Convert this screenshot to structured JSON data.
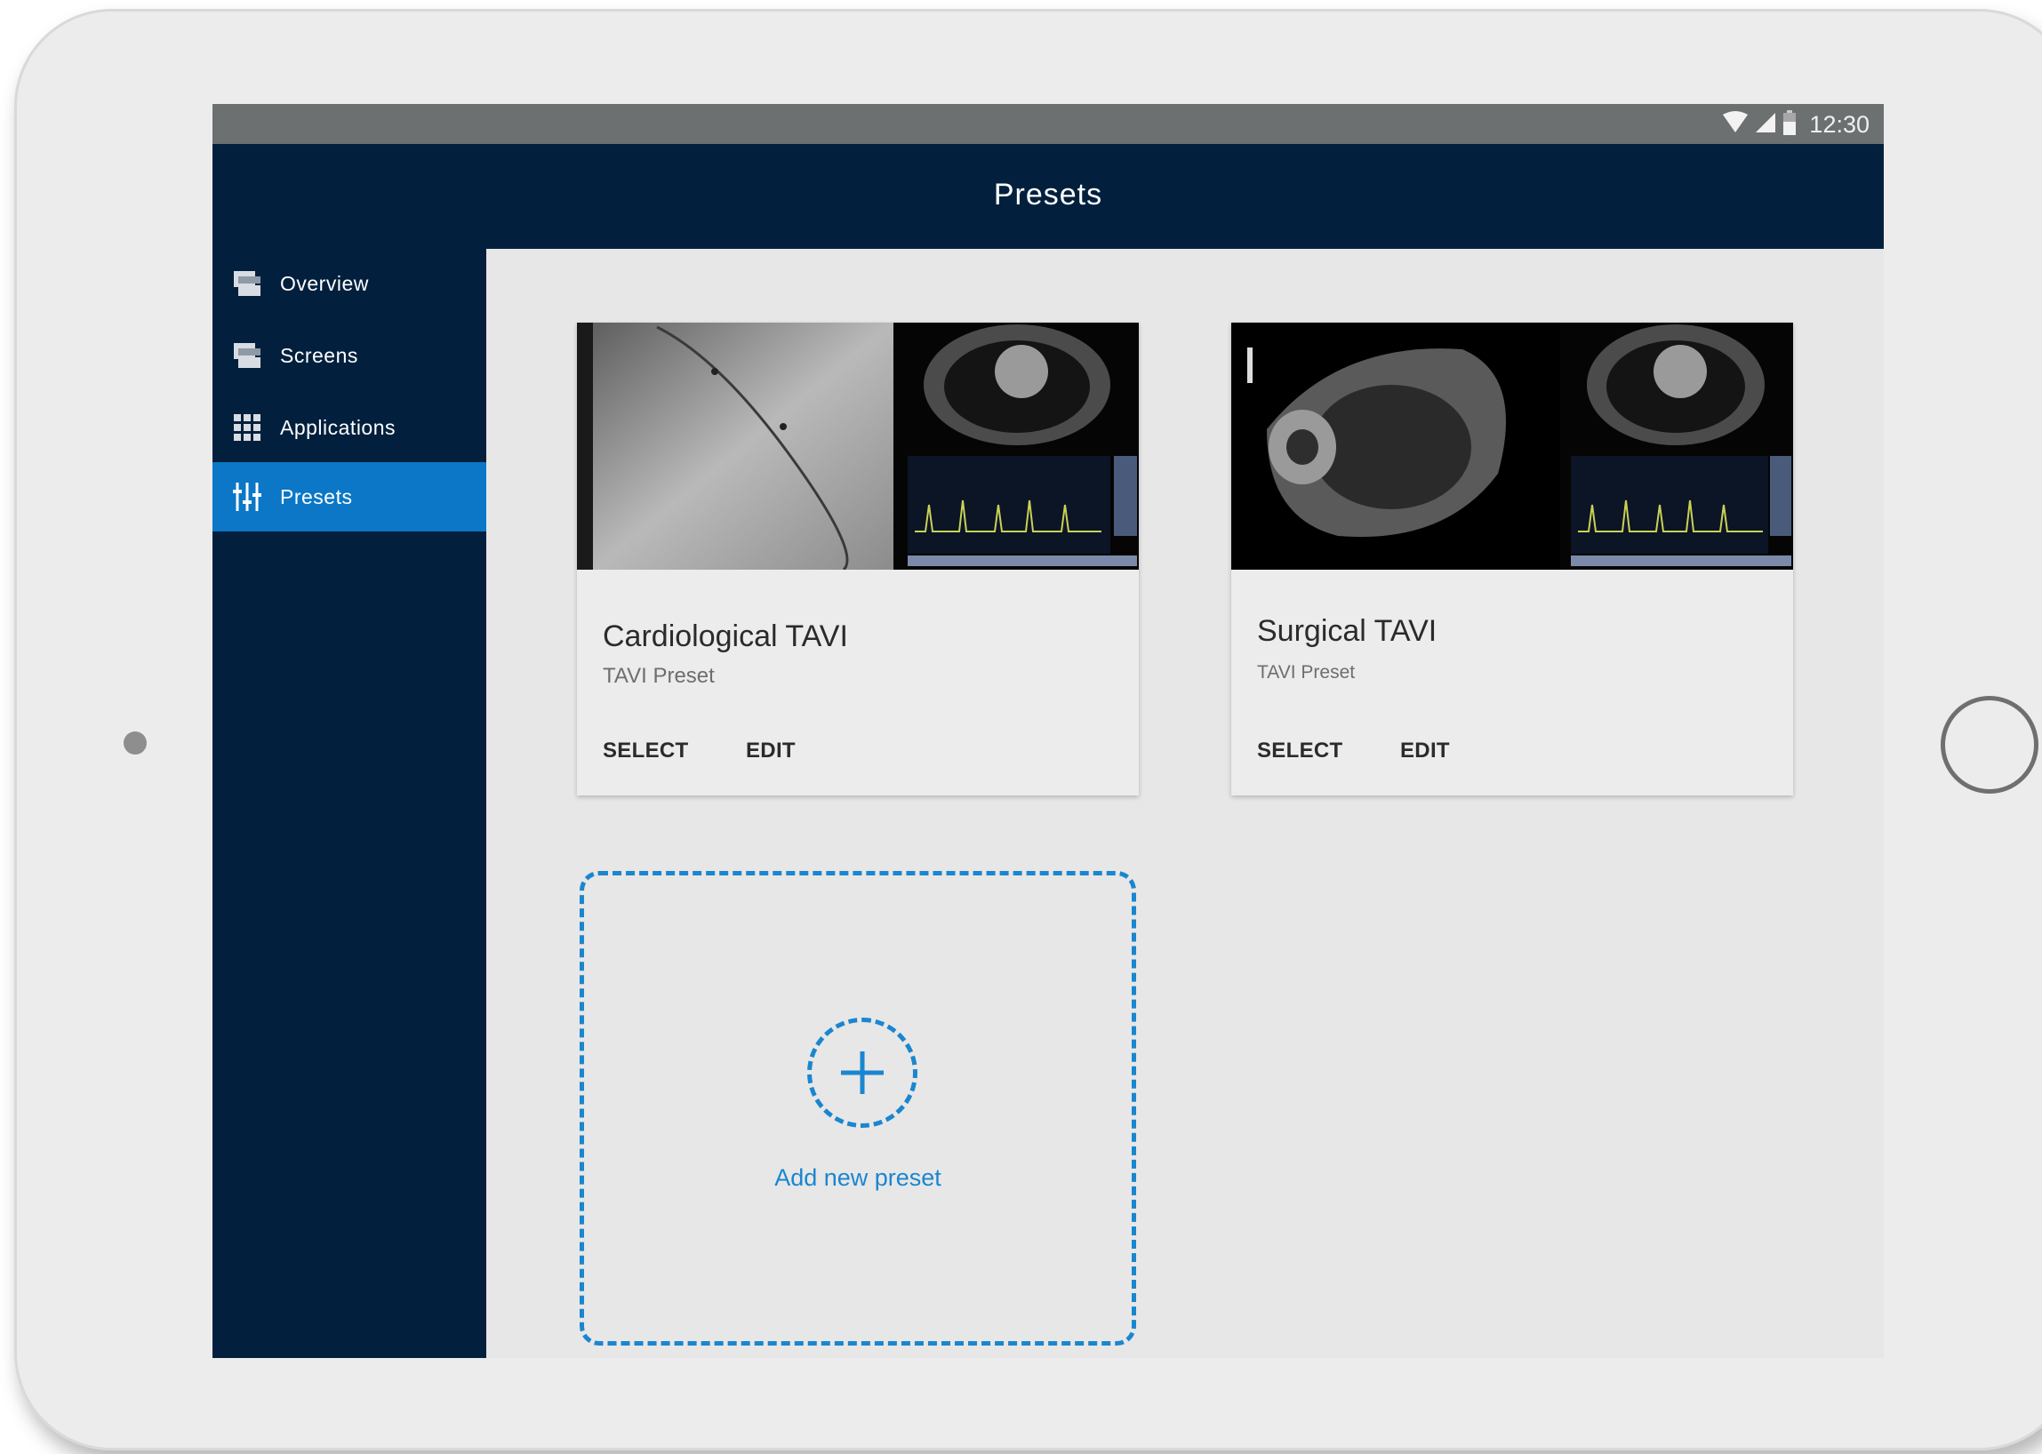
{
  "status_bar": {
    "time": "12:30"
  },
  "app_bar": {
    "title": "Presets"
  },
  "sidebar": {
    "items": [
      {
        "label": "Overview",
        "icon": "overview-icon"
      },
      {
        "label": "Screens",
        "icon": "screens-icon"
      },
      {
        "label": "Applications",
        "icon": "applications-grid-icon"
      },
      {
        "label": "Presets",
        "icon": "sliders-icon",
        "active": true
      }
    ]
  },
  "presets": [
    {
      "title": "Cardiological TAVI",
      "subtitle": "TAVI Preset",
      "select_label": "SELECT",
      "edit_label": "EDIT"
    },
    {
      "title": "Surgical TAVI",
      "subtitle": "TAVI Preset",
      "select_label": "SELECT",
      "edit_label": "EDIT"
    }
  ],
  "add_tile": {
    "label": "Add new preset"
  },
  "colors": {
    "app_bar": "#02203d",
    "active_nav": "#0b77c6",
    "accent": "#1a86cf",
    "status_bar": "#6d7070"
  }
}
